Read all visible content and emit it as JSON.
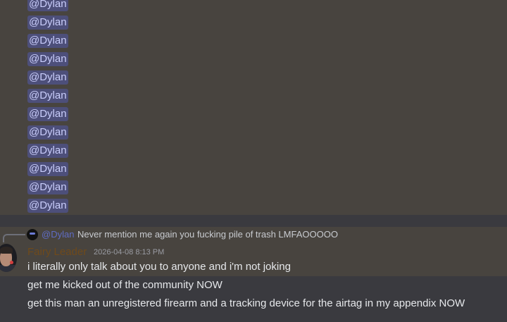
{
  "mentions": [
    "@Dylan",
    "@Dylan",
    "@Dylan",
    "@Dylan",
    "@Dylan",
    "@Dylan",
    "@Dylan",
    "@Dylan",
    "@Dylan",
    "@Dylan",
    "@Dylan",
    "@Dylan"
  ],
  "reply": {
    "mention": "@Dylan",
    "text": "Never mention me again you fucking pile of trash LMFAOOOOO"
  },
  "message": {
    "username": "Fairy Leader",
    "timestamp": "2026-04-08 8:13 PM",
    "lines": [
      "i literally only talk about you to anyone and i'm not joking",
      "get me kicked out of the community NOW",
      "get this man an unregistered firearm and a tracking device for the airtag in my appendix NOW"
    ]
  },
  "colors": {
    "mention_bg": "#4d4f7a",
    "mention_text": "#c9cdfb",
    "username": "#6f4a1b",
    "highlight_bg": "#48443f",
    "base_bg": "#3a3a3f"
  }
}
